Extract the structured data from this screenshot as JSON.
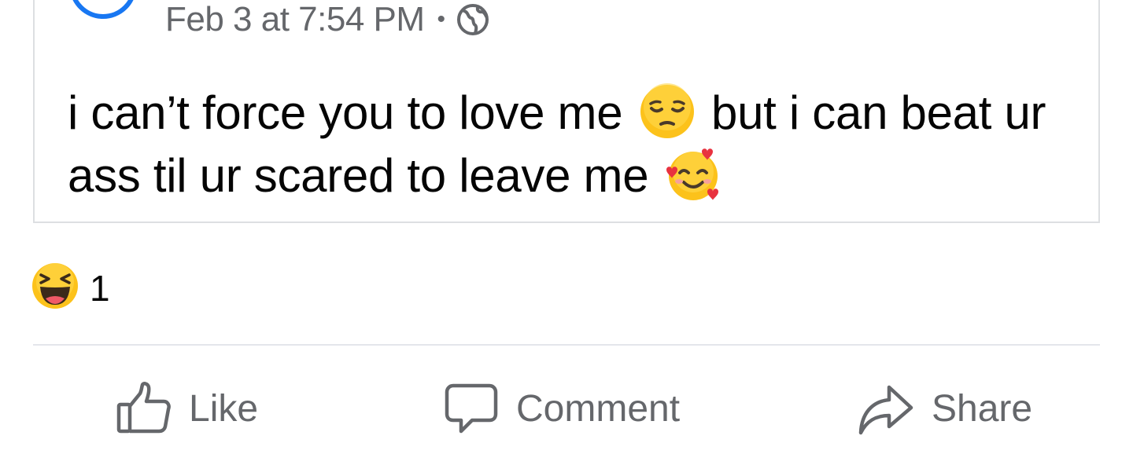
{
  "post": {
    "timestamp": "Feb 3 at 7:54 PM",
    "separator": "•",
    "privacy_icon": "globe-icon",
    "text_part1": "i can’t force you to love me",
    "emoji1": "pensive-face-emoji",
    "text_part2": "but i can beat ur ass til ur scared to leave me",
    "emoji2": "smiling-face-with-hearts-emoji"
  },
  "reactions": {
    "icon": "haha-reaction-icon",
    "count": "1"
  },
  "actions": {
    "like_label": "Like",
    "comment_label": "Comment",
    "share_label": "Share"
  },
  "colors": {
    "accent": "#1877f2",
    "secondary_text": "#65676b",
    "primary_text": "#050505",
    "divider": "#e4e6eb",
    "emoji_yellow": "#fcc21b"
  }
}
